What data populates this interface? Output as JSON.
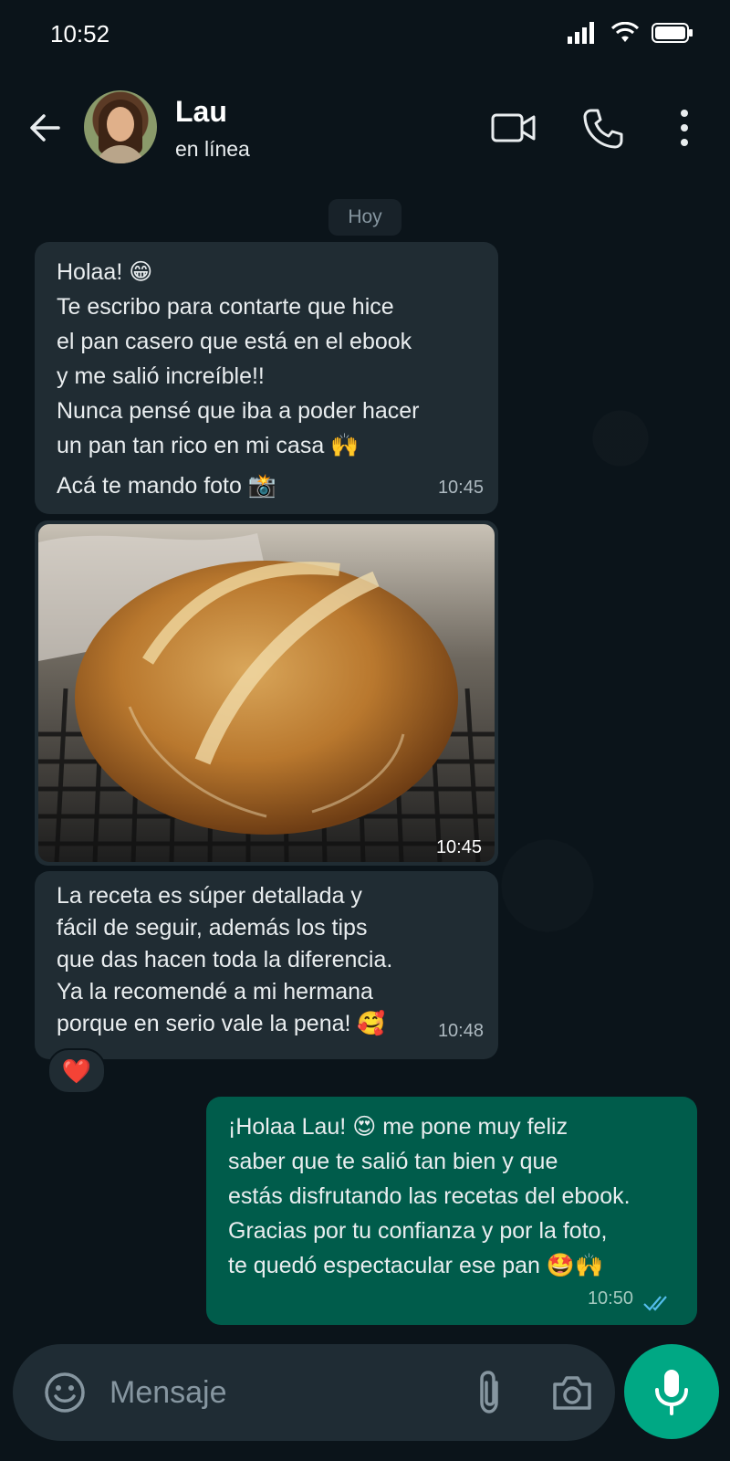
{
  "status_bar": {
    "time": "10:52"
  },
  "header": {
    "contact_name": "Lau",
    "contact_status": "en línea",
    "icons": [
      "back-arrow-icon",
      "video-call-icon",
      "phone-icon",
      "more-options-icon"
    ]
  },
  "chat": {
    "date_chip": "Hoy",
    "messages": [
      {
        "direction": "incoming",
        "lines": [
          "Holaa! 😁",
          "Te escribo para contarte que hice",
          "el pan casero que está en el ebook",
          "y me salió increíble!!",
          "Nunca pensé que iba a poder hacer",
          "un pan tan rico en mi casa 🙌",
          "Acá te mando foto 📸"
        ],
        "time": "10:45"
      },
      {
        "direction": "incoming",
        "type": "image",
        "image_subject": "round crusty sourdough loaf on a cooling rack",
        "time": "10:45"
      },
      {
        "direction": "incoming",
        "lines": [
          "La receta es súper detallada y",
          "fácil de seguir, además los tips",
          "que das hacen toda la diferencia.",
          "Ya la recomendé a mi hermana",
          "porque en serio vale la pena! 🥰"
        ],
        "time": "10:48",
        "reaction": "❤️"
      },
      {
        "direction": "outgoing",
        "lines": [
          "¡Holaa Lau! 😍 me pone muy feliz",
          "saber que te salió tan bien y que",
          "estás disfrutando las recetas del ebook.",
          "Gracias por tu confianza y por la foto,",
          "te quedó espectacular ese pan 🤩🙌"
        ],
        "time": "10:50",
        "status": "read"
      }
    ]
  },
  "input": {
    "placeholder": "Mensaje",
    "icons": [
      "emoji-icon",
      "attach-icon",
      "camera-icon",
      "mic-icon"
    ]
  },
  "colors": {
    "background": "#0b141a",
    "incoming_bubble": "#202c33",
    "outgoing_bubble": "#005c4b",
    "accent": "#00a884",
    "read_ticks": "#53bdeb"
  }
}
